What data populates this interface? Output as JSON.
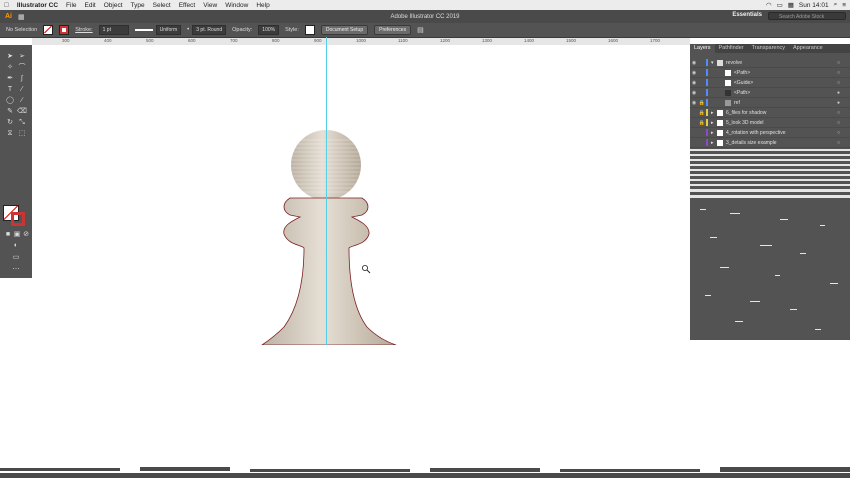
{
  "menubar": {
    "app_name": "Illustrator CC",
    "items": [
      "File",
      "Edit",
      "Object",
      "Type",
      "Select",
      "Effect",
      "View",
      "Window",
      "Help"
    ],
    "clock": "Sun 14:01"
  },
  "app": {
    "title": "Adobe Illustrator CC 2019",
    "workspace": "Essentials",
    "search_placeholder": "Search Adobe Stock"
  },
  "control": {
    "selection": "No Selection",
    "stroke_label": "Stroke:",
    "stroke_value": "1 pt",
    "profile": "Uniform",
    "brush": "3 pt. Round",
    "opacity_label": "Opacity:",
    "opacity_value": "100%",
    "style_label": "Style:",
    "doc_setup": "Document Setup",
    "preferences": "Preferences"
  },
  "ruler": {
    "ticks": [
      "300",
      "400",
      "500",
      "600",
      "700",
      "800",
      "900",
      "1000",
      "1100",
      "1200",
      "1300",
      "1400",
      "1500",
      "1600",
      "1700"
    ]
  },
  "panel": {
    "tabs": [
      "Layers",
      "Pathfinder",
      "Transparency",
      "Appearance"
    ],
    "layers": [
      {
        "name": "revolve",
        "color": "#4f8cff",
        "thumb": false
      },
      {
        "name": "<Path>",
        "color": "#4f8cff",
        "thumb": true
      },
      {
        "name": "<Guide>",
        "color": "#4f8cff",
        "thumb": true
      },
      {
        "name": "<Path>",
        "color": "#4f8cff",
        "thumb": true
      },
      {
        "name": "ref",
        "color": "#4f8cff",
        "thumb": true
      },
      {
        "name": "6_files for shadow",
        "color": "#e0d03a",
        "thumb": false
      },
      {
        "name": "5_look 3D model",
        "color": "#e0d03a",
        "thumb": false
      },
      {
        "name": "4_rotation with perspective",
        "color": "#8a4ad0",
        "thumb": false
      },
      {
        "name": "3_details size example",
        "color": "#8a4ad0",
        "thumb": false
      }
    ]
  },
  "colors": {
    "pawn": "#d8cfc3",
    "pawn_outline": "#7a1f22",
    "guide": "#52d0e8",
    "ui_dark": "#535353"
  }
}
